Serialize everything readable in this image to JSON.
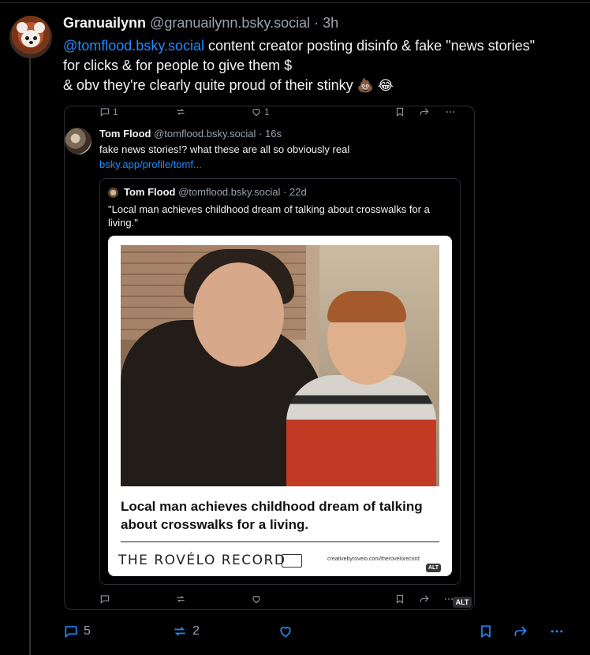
{
  "post": {
    "author_name": "Granuailynn",
    "author_handle": "@granuailynn.bsky.social",
    "separator": "·",
    "time": "3h",
    "mention": "@tomflood.bsky.social",
    "text_line1": " content creator posting disinfo & fake \"news stories\" for clicks & for people to give them $",
    "text_line2": "& obv they're clearly quite proud of their stinky",
    "emoji1": "💩",
    "emoji2": "😂",
    "actions": {
      "reply_count": "5",
      "repost_count": "2"
    }
  },
  "quoted_actions_top": {
    "reply_count": "1",
    "like_count": "1"
  },
  "quoted_post": {
    "author_name": "Tom Flood",
    "author_handle": "@tomflood.bsky.social",
    "separator": "·",
    "time": "16s",
    "text": "fake news stories!? what these are all so obviously real",
    "link": "bsky.app/profile/tomf..."
  },
  "inner_quote": {
    "author_name": "Tom Flood",
    "author_handle": "@tomflood.bsky.social",
    "separator": "·",
    "time": "22d",
    "text": "\"Local man achieves childhood dream of talking about crosswalks for a living.\""
  },
  "image_card": {
    "headline": "Local man achieves childhood dream of talking about crosswalks for a living.",
    "brand": "THE ROVÉLO RECORD",
    "site": "creativebyrovelo.com/therovelorecord",
    "alt_badge": "ALT"
  },
  "outer_alt_badge": "ALT"
}
